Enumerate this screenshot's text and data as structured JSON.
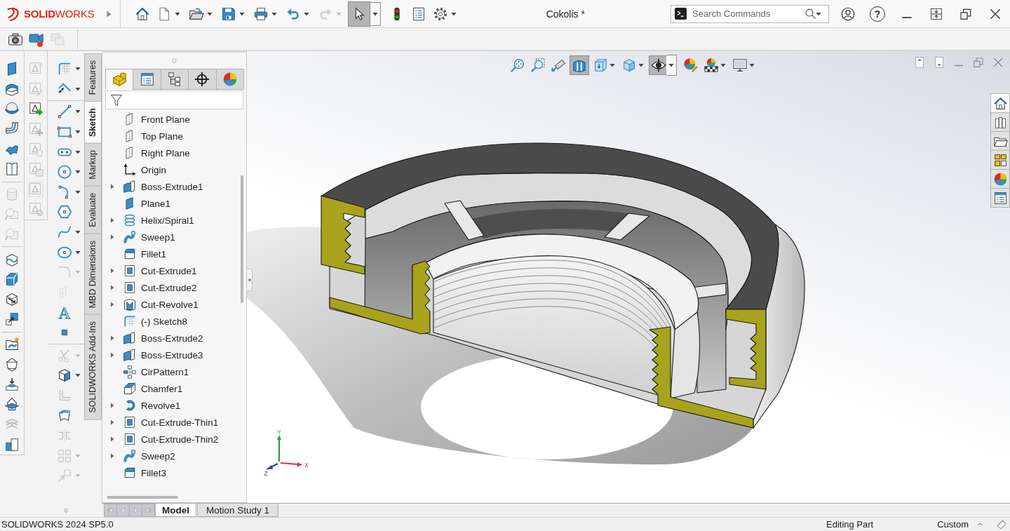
{
  "title_bar": {
    "brand": "**SOLID**WORKS",
    "document_title": "Cokolis *",
    "search": {
      "placeholder": "Search Commands"
    },
    "help": "?"
  },
  "standard_toolbar": [
    {
      "kind": "home",
      "dropdown": false,
      "disabled": false,
      "selected": false
    },
    {
      "kind": "new",
      "dropdown": true,
      "disabled": false,
      "selected": false
    },
    {
      "kind": "open",
      "dropdown": true,
      "disabled": false,
      "selected": false
    },
    {
      "kind": "save",
      "dropdown": true,
      "disabled": false,
      "selected": false
    },
    {
      "kind": "print",
      "dropdown": true,
      "disabled": false,
      "selected": false
    },
    {
      "kind": "undo",
      "dropdown": true,
      "disabled": false,
      "selected": false
    },
    {
      "kind": "redo",
      "dropdown": true,
      "disabled": true,
      "selected": false
    },
    {
      "kind": "select",
      "dropdown": true,
      "disabled": false,
      "selected": true
    },
    {
      "kind": "rebuild",
      "dropdown": false,
      "disabled": false,
      "selected": false
    },
    {
      "kind": "file_properties",
      "dropdown": false,
      "disabled": false,
      "selected": false
    },
    {
      "kind": "options",
      "dropdown": true,
      "disabled": false,
      "selected": false
    }
  ],
  "capture_toolbar": [
    {
      "kind": "camera",
      "disabled": false
    },
    {
      "kind": "video_camera",
      "disabled": false
    },
    {
      "kind": "stacked_frames",
      "disabled": true
    }
  ],
  "command_manager": {
    "columns": [
      [
        [
          {
            "kind": "plate",
            "disabled": false
          },
          {
            "kind": "curved_sheet",
            "disabled": false
          },
          {
            "kind": "sphere",
            "disabled": false
          },
          {
            "kind": "bent_pipe",
            "disabled": false
          },
          {
            "kind": "wavy_patch",
            "disabled": false
          },
          {
            "kind": "zipper",
            "disabled": false
          }
        ],
        [
          {
            "kind": "cylinder",
            "disabled": true
          },
          {
            "kind": "magnifier_block",
            "disabled": true
          },
          {
            "kind": "magnifier_block",
            "disabled": true
          }
        ],
        [
          {
            "kind": "wavy_cube",
            "disabled": false
          },
          {
            "kind": "block",
            "disabled": false
          },
          {
            "kind": "cube_arrow",
            "disabled": false
          },
          {
            "kind": "boxes_arrow",
            "disabled": false
          }
        ],
        [
          {
            "kind": "folder_spark",
            "disabled": false
          },
          {
            "kind": "gem",
            "disabled": false
          },
          {
            "kind": "tray_arrow",
            "disabled": false
          },
          {
            "kind": "gem_plane",
            "disabled": false
          },
          {
            "kind": "chevron_stack",
            "disabled": true
          },
          {
            "kind": "blocks",
            "disabled": false
          }
        ]
      ],
      [
        [
          {
            "kind": "note_spark",
            "disabled": true
          },
          {
            "kind": "note_pencil",
            "disabled": true
          },
          {
            "kind": "note_arrow",
            "disabled": false
          },
          {
            "kind": "note_plus",
            "disabled": true
          },
          {
            "kind": "note_tag",
            "disabled": true
          },
          {
            "kind": "note_disk",
            "disabled": true
          },
          {
            "kind": "note_frame",
            "disabled": true
          },
          {
            "kind": "note_link",
            "disabled": true
          }
        ]
      ],
      [
        [
          {
            "kind": "grid_corner",
            "disabled": false,
            "dropdown": true
          },
          {
            "kind": "angle_dimension",
            "disabled": false,
            "dropdown": true
          }
        ],
        [
          {
            "kind": "line",
            "disabled": false,
            "dropdown": true
          },
          {
            "kind": "rectangle",
            "disabled": false,
            "dropdown": true
          },
          {
            "kind": "slot",
            "disabled": false,
            "dropdown": true
          },
          {
            "kind": "circle",
            "disabled": false,
            "dropdown": true
          },
          {
            "kind": "arc",
            "disabled": false,
            "dropdown": true
          },
          {
            "kind": "hexagon",
            "disabled": false,
            "dropdown": false
          },
          {
            "kind": "spline",
            "disabled": false,
            "dropdown": true
          },
          {
            "kind": "ellipse",
            "disabled": false,
            "dropdown": true
          },
          {
            "kind": "rounded_corner",
            "disabled": true,
            "dropdown": true
          },
          {
            "kind": "dotted_plane",
            "disabled": true,
            "dropdown": false
          },
          {
            "kind": "glyph",
            "glyph": "A",
            "disabled": false,
            "dropdown": false
          },
          {
            "kind": "point",
            "disabled": false,
            "dropdown": false
          }
        ],
        [
          {
            "kind": "scissors",
            "disabled": true,
            "dropdown": true
          },
          {
            "kind": "cube",
            "disabled": false,
            "dropdown": true
          },
          {
            "kind": "offset_lines",
            "disabled": true,
            "dropdown": false
          },
          {
            "kind": "curved_patch",
            "disabled": false,
            "dropdown": false
          },
          {
            "kind": "mirror",
            "disabled": true,
            "dropdown": false
          },
          {
            "kind": "grid_squares",
            "disabled": true,
            "dropdown": true
          },
          {
            "kind": "move_arrow",
            "disabled": true,
            "dropdown": true
          }
        ]
      ]
    ],
    "tabs": [
      {
        "label": "Features",
        "selected": false
      },
      {
        "label": "Sketch",
        "selected": true
      },
      {
        "label": "Markup",
        "selected": false
      },
      {
        "label": "Evaluate",
        "selected": false
      },
      {
        "label": "MBD Dimensions",
        "selected": false
      },
      {
        "label": "SOLIDWORKS Add-Ins",
        "selected": false
      }
    ]
  },
  "feature_manager": {
    "tabs": [
      {
        "kind": "part_block",
        "selected": true
      },
      {
        "kind": "property_list",
        "selected": false
      },
      {
        "kind": "tree_diagram",
        "selected": false
      },
      {
        "kind": "crosshair",
        "selected": false
      },
      {
        "kind": "color_ball",
        "selected": false
      }
    ],
    "tree": [
      {
        "label": "Front Plane",
        "kind": "dashed_plane"
      },
      {
        "label": "Top Plane",
        "kind": "dashed_plane"
      },
      {
        "label": "Right Plane",
        "kind": "dashed_plane"
      },
      {
        "label": "Origin",
        "kind": "axes"
      },
      {
        "label": "Boss-Extrude1",
        "kind": "extruded_block",
        "expanded": false
      },
      {
        "label": "Plane1",
        "kind": "plane"
      },
      {
        "label": "Helix/Spiral1",
        "kind": "helix",
        "expanded": false
      },
      {
        "label": "Sweep1",
        "kind": "swept_tube",
        "expanded": false
      },
      {
        "label": "Fillet1",
        "kind": "rounded_block"
      },
      {
        "label": "Cut-Extrude1",
        "kind": "cut_block",
        "expanded": false
      },
      {
        "label": "Cut-Extrude2",
        "kind": "cut_block",
        "expanded": false
      },
      {
        "label": "Cut-Revolve1",
        "kind": "cut_cylinder",
        "expanded": false
      },
      {
        "label": "(-) Sketch8",
        "kind": "grid_corner"
      },
      {
        "label": "Boss-Extrude2",
        "kind": "extruded_block",
        "expanded": false
      },
      {
        "label": "Boss-Extrude3",
        "kind": "extruded_block",
        "expanded": false
      },
      {
        "label": "CirPattern1",
        "kind": "pattern_squares"
      },
      {
        "label": "Chamfer1",
        "kind": "chamfered_cube"
      },
      {
        "label": "Revolve1",
        "kind": "revolved_ring",
        "expanded": false
      },
      {
        "label": "Cut-Extrude-Thin1",
        "kind": "cut_block",
        "expanded": false
      },
      {
        "label": "Cut-Extrude-Thin2",
        "kind": "cut_block",
        "expanded": false
      },
      {
        "label": "Sweep2",
        "kind": "swept_tube",
        "expanded": false
      },
      {
        "label": "Fillet3",
        "kind": "rounded_block"
      }
    ]
  },
  "view_toolbar": [
    {
      "kind": "zoom_fit",
      "dropdown": false,
      "selected": false
    },
    {
      "kind": "zoom_area",
      "dropdown": false,
      "selected": false
    },
    {
      "kind": "telescope_arrow",
      "dropdown": false,
      "selected": false
    },
    {
      "kind": "sectioned_cylinder",
      "dropdown": false,
      "selected": true
    },
    {
      "kind": "view_cube",
      "dropdown": true,
      "selected": false
    },
    {
      "kind": "shaded_cube",
      "dropdown": true,
      "selected": false
    },
    {
      "kind": "eye",
      "dropdown": true,
      "selected": true
    },
    {
      "kind": "ball_pencil",
      "dropdown": false,
      "selected": false
    },
    {
      "kind": "ball_checker",
      "dropdown": true,
      "selected": false
    },
    {
      "kind": "monitor",
      "dropdown": true,
      "selected": false
    }
  ],
  "task_pane": [
    {
      "kind": "home",
      "selected": true
    },
    {
      "kind": "books",
      "selected": false
    },
    {
      "kind": "folder",
      "selected": false
    },
    {
      "kind": "palette_grid",
      "selected": false
    },
    {
      "kind": "color_ball",
      "selected": false
    },
    {
      "kind": "property_list",
      "selected": false
    }
  ],
  "triad": {
    "axes": [
      {
        "label": "Y",
        "color": "#2e9e3a"
      },
      {
        "label": "X",
        "color": "#d9342b"
      },
      {
        "label": "Z",
        "color": "#2c3fc7"
      }
    ]
  },
  "bottom_tabs": [
    {
      "label": "Model",
      "selected": true
    },
    {
      "label": "Motion Study 1",
      "selected": false
    }
  ],
  "status_bar": {
    "version": "SOLIDWORKS 2024 SP5.0",
    "mode": "Editing Part",
    "units": "Custom"
  }
}
